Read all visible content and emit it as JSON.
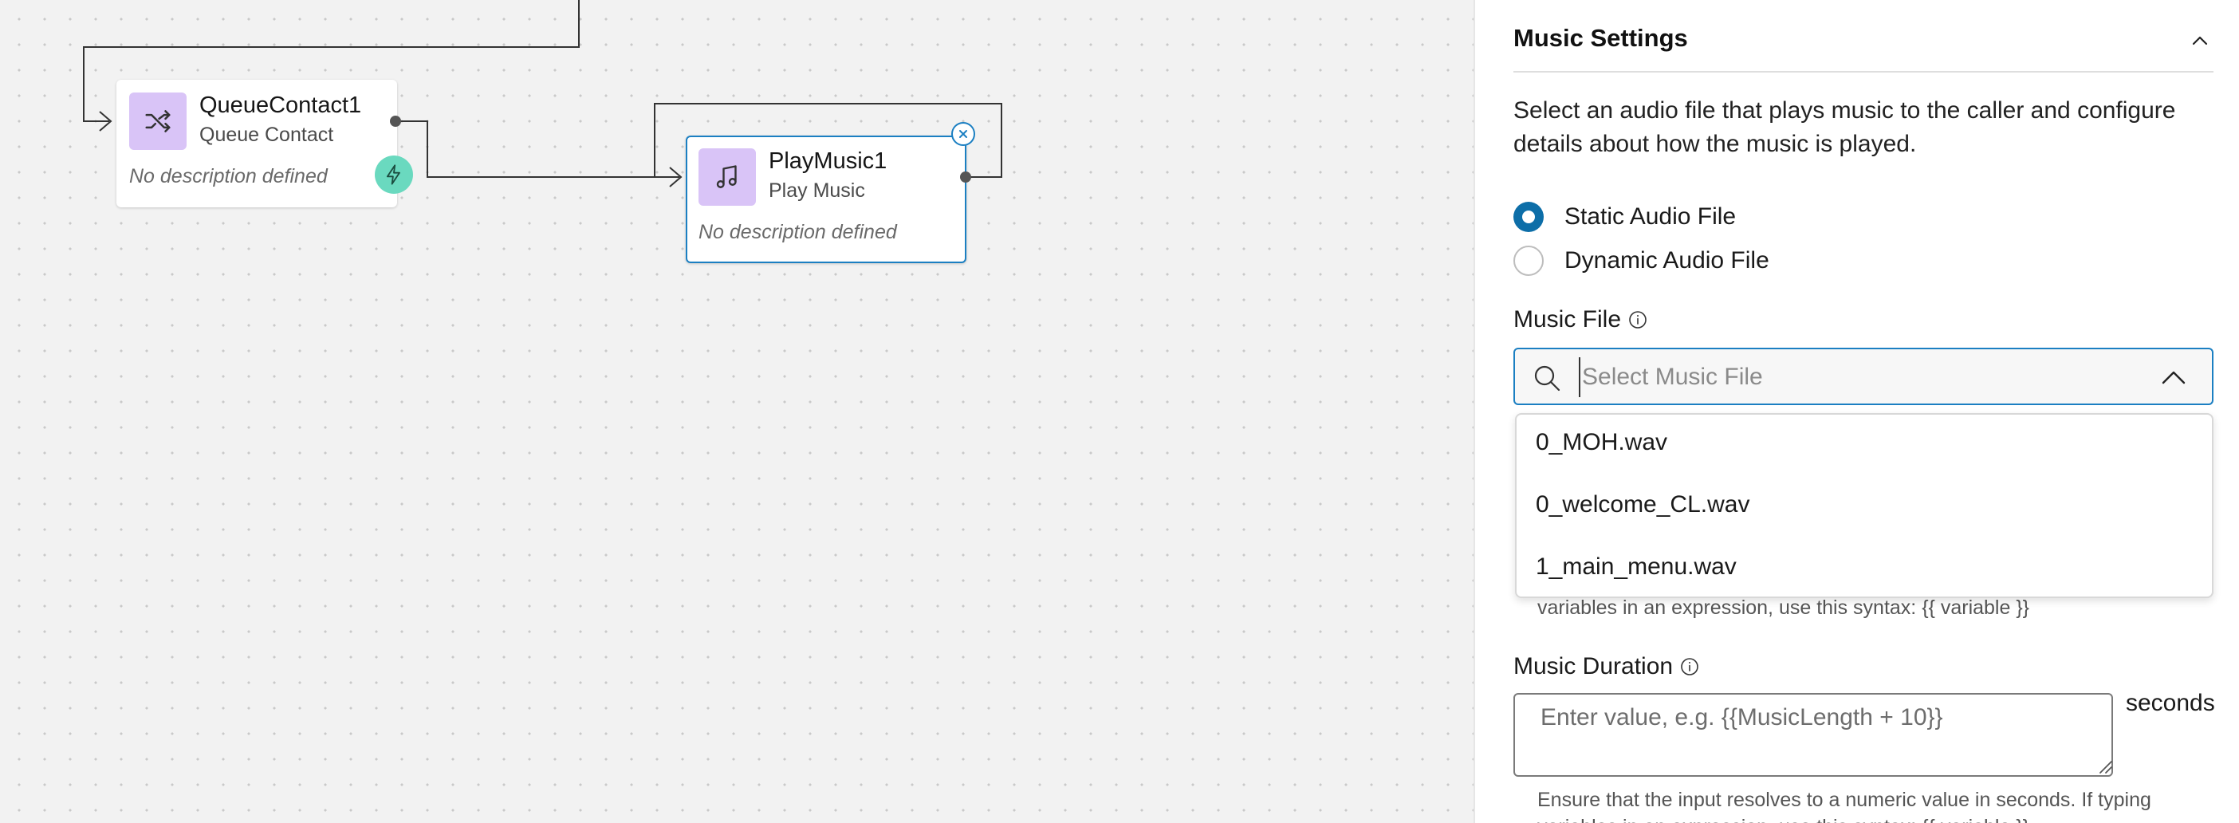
{
  "canvas": {
    "nodes": [
      {
        "title": "QueueContact1",
        "subtitle": "Queue Contact",
        "description": "No description defined",
        "icon": "shuffle-icon"
      },
      {
        "title": "PlayMusic1",
        "subtitle": "Play Music",
        "description": "No description defined",
        "icon": "music-note-icon"
      }
    ]
  },
  "panel": {
    "title": "Music Settings",
    "description": "Select an audio file that plays music to the caller and configure details about how the music is played.",
    "radio_options": [
      {
        "label": "Static Audio File",
        "checked": true
      },
      {
        "label": "Dynamic Audio File",
        "checked": false
      }
    ],
    "music_file": {
      "label": "Music File",
      "placeholder": "Select Music File",
      "options": [
        "0_MOH.wav",
        "0_welcome_CL.wav",
        "1_main_menu.wav"
      ]
    },
    "music_file_helper_partial": "variables in an expression, use this syntax: {{ variable }}",
    "music_duration": {
      "label": "Music Duration",
      "placeholder": "Enter value, e.g. {{MusicLength + 10}}",
      "unit": "seconds",
      "helper": "Ensure that the input resolves to a numeric value in seconds. If typing variables in an expression, use this syntax: {{ variable }}"
    }
  },
  "colors": {
    "accent": "#1b7fc2",
    "radio_checked": "#0d6ea8",
    "node_icon_bg": "#d9c4f7",
    "event_button": "#6ad9bf",
    "canvas_bg": "#f2f2f2"
  }
}
